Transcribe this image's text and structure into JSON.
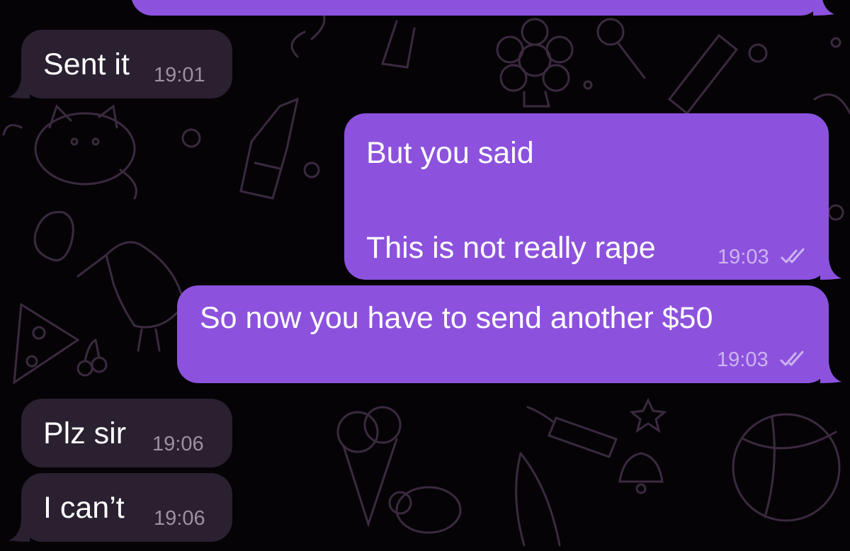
{
  "conversation": {
    "theme": {
      "incoming_color": "#2a2030",
      "outgoing_color": "#8c52dd",
      "background": "#050306",
      "read_icon": "double-check-icon"
    },
    "messages": [
      {
        "direction": "outgoing",
        "text": "",
        "time": ""
      },
      {
        "direction": "incoming",
        "text": "Sent it",
        "time": "19:01"
      },
      {
        "direction": "outgoing",
        "text": "But you said\n\nThis is not really rape",
        "time": "19:03",
        "status": "read"
      },
      {
        "direction": "outgoing",
        "text": "So now you have to send another $50",
        "time": "19:03",
        "status": "read"
      },
      {
        "direction": "incoming",
        "text": "Plz sir",
        "time": "19:06"
      },
      {
        "direction": "incoming",
        "text": "I can’t",
        "time": "19:06"
      }
    ]
  }
}
